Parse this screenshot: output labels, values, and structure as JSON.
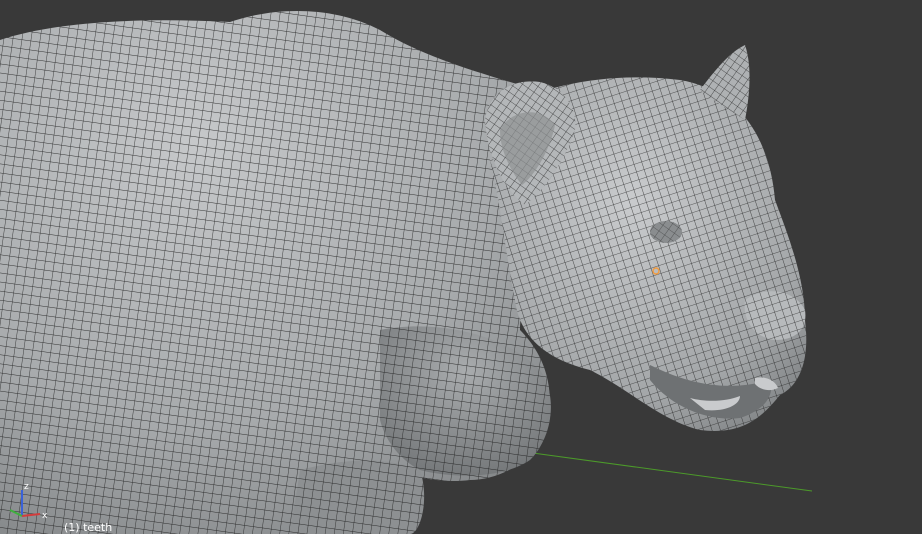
{
  "viewport": {
    "object_label": "(1) teeth",
    "background_color": "#393939",
    "grid_line_color": "#4c9a2a",
    "mesh_fill_color": "#9fa2a4",
    "wire_color": "#1b1b1b",
    "selected_vertex_color": "#f39a3c"
  },
  "axis_gizmo": {
    "x_label": "x",
    "z_label": "z",
    "x_color": "#d23c3c",
    "y_color": "#3fb03f",
    "z_color": "#3a62d8"
  }
}
